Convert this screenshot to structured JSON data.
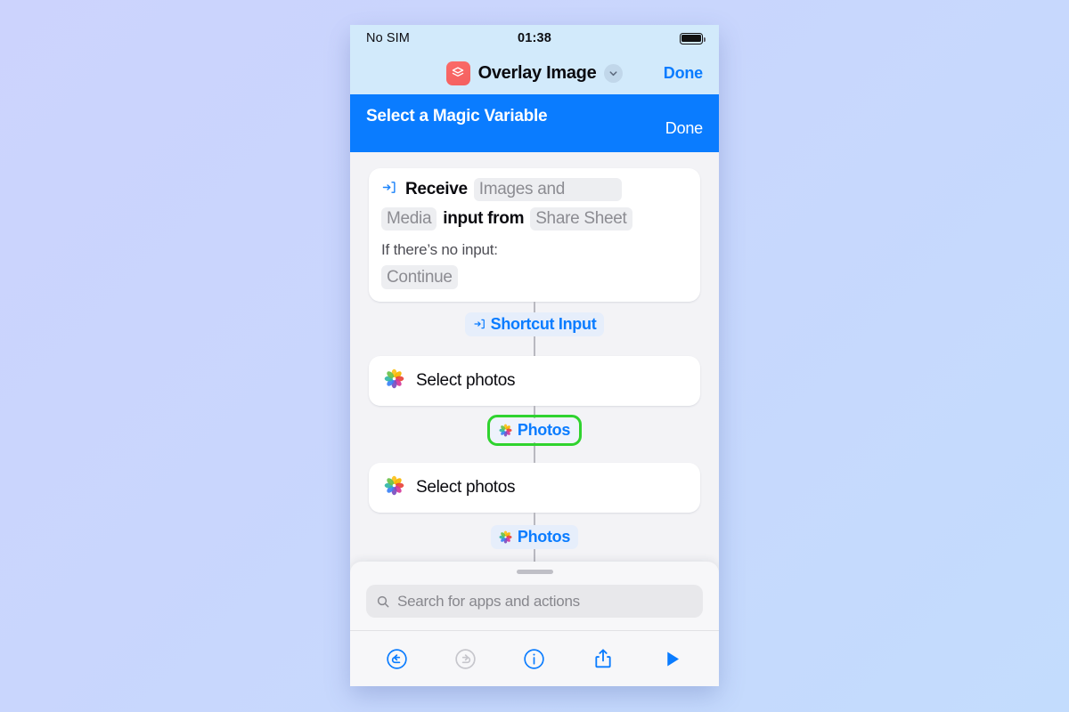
{
  "status_bar": {
    "carrier": "No SIM",
    "time": "01:38",
    "battery_icon": "battery-full-icon"
  },
  "nav": {
    "app_icon": "overlay-image-app-icon",
    "title": "Overlay Image",
    "chevron_icon": "chevron-down-icon",
    "done_label": "Done"
  },
  "magic_variable_banner": {
    "title": "Select a Magic Variable",
    "done_label": "Done",
    "background_color": "#0a7cff"
  },
  "canvas": {
    "receive_card": {
      "icon": "import-arrow-into-box-icon",
      "word_receive": "Receive",
      "pill_images_and_media_a": "Images and",
      "pill_images_and_media_b": "Media",
      "word_input_from": "input from",
      "pill_share_sheet": "Share Sheet",
      "no_input_label": "If there’s no input:",
      "pill_continue": "Continue"
    },
    "shortcut_input_chip": {
      "icon": "import-arrow-into-box-icon",
      "label": "Shortcut Input"
    },
    "action_one": {
      "icon": "photos-app-icon",
      "label": "Select photos"
    },
    "variable_one": {
      "icon": "photos-app-icon",
      "label": "Photos",
      "selected": true,
      "highlight_color": "#2fd32f"
    },
    "action_two": {
      "icon": "photos-app-icon",
      "label": "Select photos"
    },
    "variable_two": {
      "icon": "photos-app-icon",
      "label": "Photos",
      "selected": false
    }
  },
  "sheet": {
    "grabber": "drag-handle",
    "search_icon": "search-icon",
    "search_value": "",
    "search_placeholder": "Search for apps and actions"
  },
  "toolbar": {
    "undo": {
      "icon": "undo-icon",
      "enabled": true
    },
    "redo": {
      "icon": "redo-icon",
      "enabled": false
    },
    "info": {
      "icon": "info-icon",
      "enabled": true
    },
    "share": {
      "icon": "share-icon",
      "enabled": true
    },
    "play": {
      "icon": "play-icon",
      "enabled": true
    }
  },
  "colors": {
    "accent_blue": "#0a7cff",
    "status_bar_bg": "#d2eafb",
    "canvas_bg": "#f3f3f6",
    "page_bg": "#c9d6fd"
  }
}
